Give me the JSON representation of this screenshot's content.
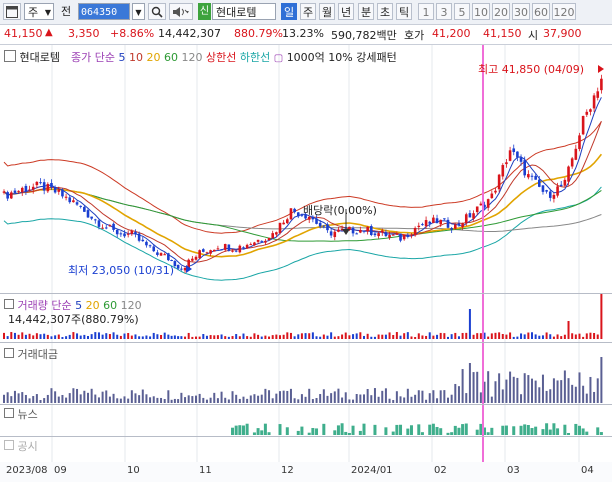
{
  "toolbar": {
    "window_icon": "window-icon",
    "market": "주",
    "prev": "전",
    "code": "064350",
    "search_icon": "search-icon",
    "sound_icon": "speaker-icon",
    "new_tag": "신",
    "name": "현대로템",
    "periods": [
      "일",
      "주",
      "월",
      "년",
      "분",
      "초",
      "틱"
    ],
    "active_period": "일",
    "intervals": [
      "1",
      "3",
      "5",
      "10",
      "20",
      "30",
      "60",
      "120"
    ]
  },
  "quote": {
    "price": "41,150",
    "change": "3,350",
    "change_pct": "+8.86%",
    "volume": "14,442,307",
    "volume_ratio": "880.79%",
    "turnover": "13.23%",
    "amount": "590,782백만",
    "bid_label": "호가",
    "ask_price": "41,200",
    "bid_price": "41,150",
    "open_label": "시",
    "open_price": "37,900"
  },
  "legend": {
    "name": "현대로템",
    "price_type": "종가",
    "ma_type": "단순",
    "ma_periods": [
      "5",
      "10",
      "20",
      "60",
      "120"
    ],
    "upper_band": "상한선",
    "lower_band": "하한선",
    "pattern": "1000억 10% 강세패턴"
  },
  "annotations": {
    "high": "최고 41,850 (04/09)",
    "low": "최저 23,050 (10/31)",
    "dividend": "배당락(0.00%)"
  },
  "volume_panel": {
    "title": "거래량",
    "ma_type": "단순",
    "ma_periods": [
      "5",
      "20",
      "60",
      "120"
    ],
    "current": "14,442,307주(880.79%)"
  },
  "panels": {
    "amount": "거래대금",
    "news": "뉴스",
    "disclosure": "공시"
  },
  "x_axis": [
    "2023/08",
    "09",
    "10",
    "11",
    "12",
    "2024/01",
    "02",
    "03",
    "04"
  ],
  "colors": {
    "up": "#d9141b",
    "down": "#1a3fd1",
    "ma5": "#1f3fbf",
    "ma10": "#c0392b",
    "ma20": "#e1a400",
    "ma60": "#2e9a35",
    "ma120": "#888888",
    "upper_band": "#cc3a24",
    "lower_band": "#1aa6a6",
    "marker": "#f06ed8",
    "news_bar": "#3fae8c",
    "amount_bar": "#5a5f93"
  },
  "chart_data": {
    "type": "candlestick",
    "x_range": [
      "2023-08-24",
      "2024-04-10"
    ],
    "ylim": [
      22000,
      43000
    ],
    "price_series": [
      {
        "d": "2023-08-24",
        "c": 30200
      },
      {
        "d": "2023-08-31",
        "c": 30800
      },
      {
        "d": "2023-09-07",
        "c": 31100
      },
      {
        "d": "2023-09-14",
        "c": 30400
      },
      {
        "d": "2023-09-21",
        "c": 29300
      },
      {
        "d": "2023-09-28",
        "c": 27900
      },
      {
        "d": "2023-10-05",
        "c": 26800
      },
      {
        "d": "2023-10-12",
        "c": 26500
      },
      {
        "d": "2023-10-19",
        "c": 25200
      },
      {
        "d": "2023-10-26",
        "c": 24300
      },
      {
        "d": "2023-10-31",
        "c": 23400
      },
      {
        "d": "2023-11-07",
        "c": 24800
      },
      {
        "d": "2023-11-14",
        "c": 25500
      },
      {
        "d": "2023-11-21",
        "c": 25300
      },
      {
        "d": "2023-11-28",
        "c": 25900
      },
      {
        "d": "2023-12-05",
        "c": 26600
      },
      {
        "d": "2023-12-12",
        "c": 28800
      },
      {
        "d": "2023-12-19",
        "c": 28300
      },
      {
        "d": "2023-12-26",
        "c": 26700
      },
      {
        "d": "2024-01-02",
        "c": 26900
      },
      {
        "d": "2024-01-09",
        "c": 27000
      },
      {
        "d": "2024-01-16",
        "c": 26600
      },
      {
        "d": "2024-01-23",
        "c": 26200
      },
      {
        "d": "2024-01-30",
        "c": 27400
      },
      {
        "d": "2024-02-06",
        "c": 27800
      },
      {
        "d": "2024-02-13",
        "c": 27300
      },
      {
        "d": "2024-02-20",
        "c": 28600
      },
      {
        "d": "2024-02-27",
        "c": 30100
      },
      {
        "d": "2024-03-05",
        "c": 34500
      },
      {
        "d": "2024-03-12",
        "c": 32000
      },
      {
        "d": "2024-03-19",
        "c": 30200
      },
      {
        "d": "2024-03-26",
        "c": 31300
      },
      {
        "d": "2024-04-02",
        "c": 37200
      },
      {
        "d": "2024-04-09",
        "c": 41150
      }
    ],
    "high": {
      "value": 41850,
      "date": "04/09"
    },
    "low": {
      "value": 23050,
      "date": "10/31"
    }
  }
}
